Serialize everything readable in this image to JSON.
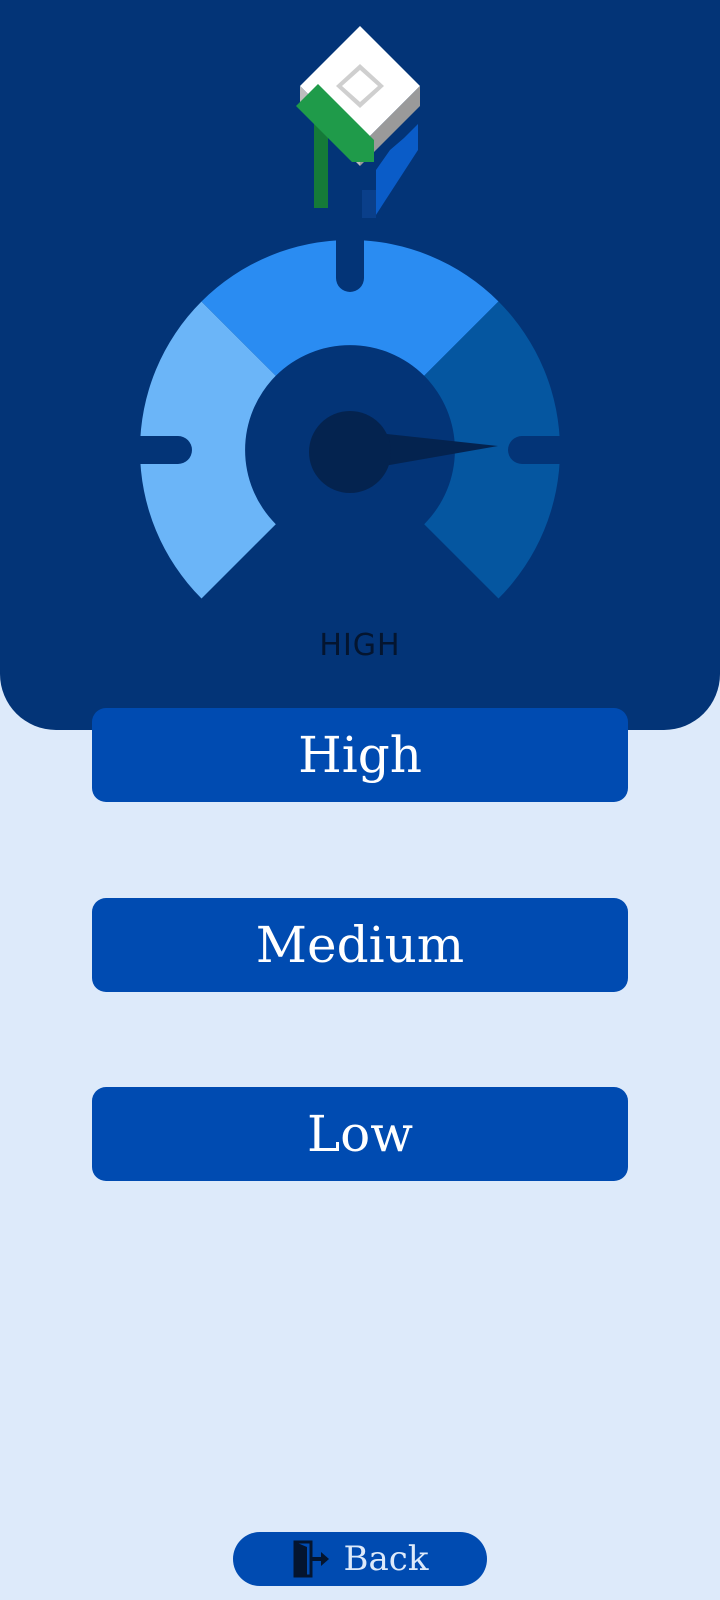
{
  "gauge": {
    "level_text": "HIGH",
    "needle_level": "high",
    "segment_colors": {
      "low": "#6bb5f8",
      "medium": "#2a8cf2",
      "high": "#0556a0"
    }
  },
  "levels": [
    {
      "label": "High"
    },
    {
      "label": "Medium"
    },
    {
      "label": "Low"
    }
  ],
  "back": {
    "label": "Back",
    "icon": "exit-door-icon"
  },
  "colors": {
    "header_bg": "#033477",
    "page_bg": "#ddeafa",
    "button_bg": "#004bb1",
    "button_text": "#ffffff"
  }
}
